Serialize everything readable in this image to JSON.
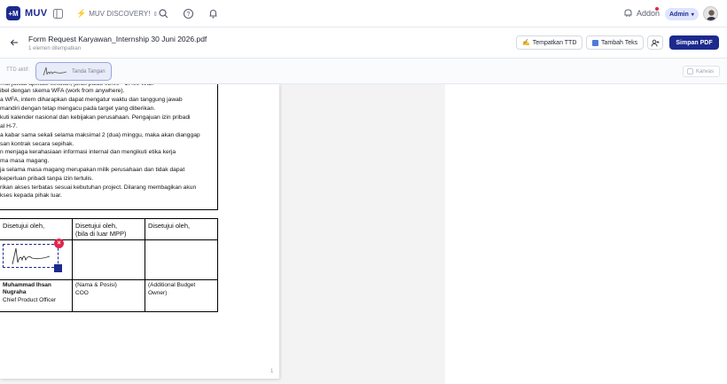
{
  "app": {
    "logo_mark": "+M",
    "name": "MUV"
  },
  "workspace": {
    "label": "MUV DISCOVERY!"
  },
  "header": {
    "addon_label": "Addon",
    "user_role": "Admin"
  },
  "document": {
    "title": "Form Request Karyawan_Internship 30 Juni 2026.pdf",
    "subtitle": "1 elemen ditempatkan",
    "buttons": {
      "place_signature": "Tempatkan TTD",
      "add_text": "Tambah Teks",
      "save_pdf": "Simpan PDF"
    }
  },
  "signature_bar": {
    "active_label": "TTD aktif:",
    "signature_name": "Tanda Tangan",
    "canvas_label": "Kanvas"
  },
  "page": {
    "body_lines": [
      "...at jawab aplikasi sekolah, jarak pulau 08.00 - 17.00 WIB.",
      "ibel dengan skema WFA (work from anywhere).",
      "a WFA, intern diharapkan dapat mengatur waktu dan tanggung jawab",
      "mandiri dengan tetap mengacu pada target yang diberikan.",
      "kuti kalender nasional dan kebijakan perusahaan. Pengajuan izin pribadi",
      "al H-7.",
      "a kabar sama sekali selama maksimal 2 (dua) minggu, maka akan dianggap",
      "san kontrak secara sepihak.",
      "n menjaga kerahasiaan informasi internal dan mengikuti etika kerja",
      "ma masa magang.",
      "ja selama masa magang merupakan milik perusahaan dan tidak dapat",
      "keperluan pribadi tanpa izin tertulis.",
      "rikan akses terbatas sesuai kebutuhan project. Dilarang membagikan akun",
      "kses kepada pihak luar."
    ],
    "approval_table": {
      "col1_header": "Disetujui oleh,",
      "col2_header_line1": "Disetujui oleh,",
      "col2_header_line2": "(bila di luar MPP)",
      "col3_header": "Disetujui oleh,",
      "signer_name_line1": "Muhammad Ihsan",
      "signer_name_line2": "Nugraha",
      "signer_title": "Chief Product Officer",
      "col2_footer_line1": "(Nama & Posisi)",
      "col2_footer_line2": "COO",
      "col3_footer_line1": "(Additional Budget",
      "col3_footer_line2": "Owner)"
    },
    "page_number": "1"
  },
  "colors": {
    "brand": "#1c2a8e",
    "danger": "#e0264b",
    "admin_pill": "#dfe5ff"
  }
}
